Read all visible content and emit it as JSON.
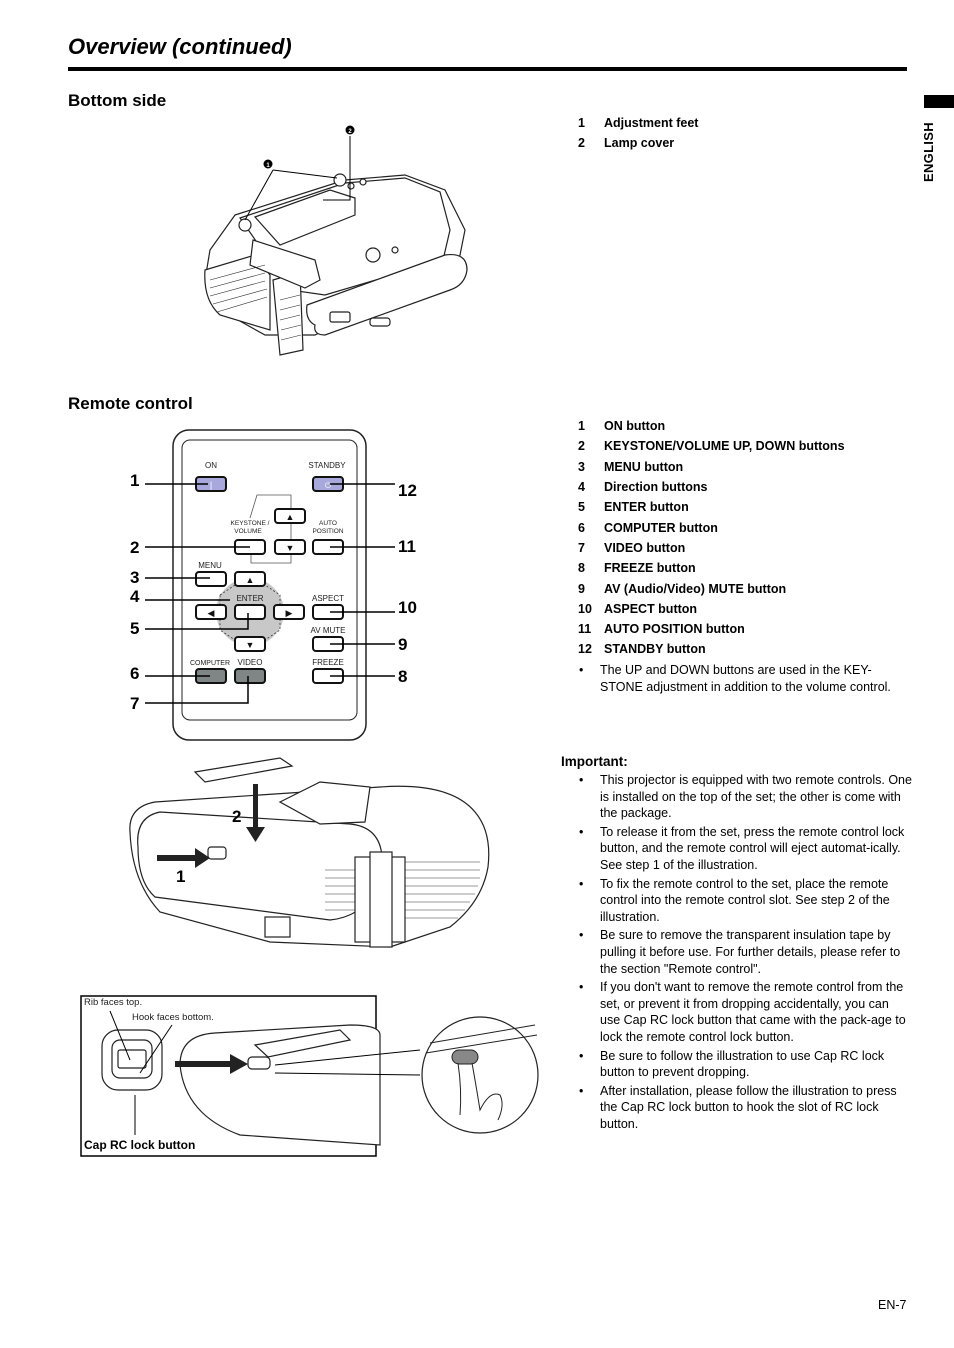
{
  "page": {
    "title": "Overview (continued)",
    "language_tab": "ENGLISH",
    "page_number": "EN-7"
  },
  "bottom_side": {
    "heading": "Bottom side",
    "callouts": [
      "1",
      "2"
    ],
    "items": [
      {
        "num": "1",
        "label": "Adjustment feet"
      },
      {
        "num": "2",
        "label": "Lamp cover"
      }
    ]
  },
  "remote_control": {
    "heading": "Remote control",
    "diagram": {
      "button_labels": {
        "on": "ON",
        "standby": "STANDBY",
        "keystone_volume_line1": "KEYSTONE /",
        "keystone_volume_line2": "VOLUME",
        "auto_position_line1": "AUTO",
        "auto_position_line2": "POSITION",
        "menu": "MENU",
        "enter": "ENTER",
        "aspect": "ASPECT",
        "av_mute": "AV MUTE",
        "computer": "COMPUTER",
        "video": "VIDEO",
        "freeze": "FREEZE"
      },
      "glyphs": {
        "on": "|",
        "standby": "⏻",
        "up": "▲",
        "down": "▼",
        "left": "◀",
        "right": "▶"
      },
      "callouts_left": [
        "1",
        "2",
        "3",
        "4",
        "5",
        "6",
        "7"
      ],
      "callouts_right": [
        "12",
        "11",
        "10",
        "9",
        "8"
      ],
      "colors": {
        "power_buttons": "#a9a8dc",
        "source_buttons": "#7f8685",
        "dpad_ring": "#c8c8c8"
      }
    },
    "items": [
      {
        "num": "1",
        "label": "ON button"
      },
      {
        "num": "2",
        "label": "KEYSTONE/VOLUME UP, DOWN buttons"
      },
      {
        "num": "3",
        "label": "MENU button"
      },
      {
        "num": "4",
        "label": "Direction buttons"
      },
      {
        "num": "5",
        "label": "ENTER button"
      },
      {
        "num": "6",
        "label": "COMPUTER button"
      },
      {
        "num": "7",
        "label": "VIDEO button"
      },
      {
        "num": "8",
        "label": "FREEZE button"
      },
      {
        "num": "9",
        "label": "AV (Audio/Video) MUTE button"
      },
      {
        "num": "10",
        "label": "ASPECT button"
      },
      {
        "num": "11",
        "label": "AUTO POSITION button"
      },
      {
        "num": "12",
        "label": "STANDBY button"
      }
    ],
    "note": "The UP and DOWN buttons are used in the KEY-STONE adjustment in addition to the volume control.",
    "note_line1": "The UP and DOWN buttons are used in the KEY-",
    "note_line2": "STONE adjustment in addition to the volume control."
  },
  "remote_mount_figure": {
    "step_labels": [
      "1",
      "2"
    ]
  },
  "cap_figure": {
    "rib_label": "Rib faces top.",
    "hook_label": "Hook faces bottom.",
    "caption": "Cap RC lock button"
  },
  "important": {
    "heading": "Important:",
    "bullet_char": "•",
    "items": [
      "This projector is equipped with two remote controls. One is installed on the top of the set; the other is come with the package.",
      "To release it from the set, press the remote control lock button, and the remote control will eject automat-ically. See step 1 of the illustration.",
      "To fix the remote control to the set, place the remote control into the remote control slot. See step 2 of the illustration.",
      "Be sure to remove the transparent insulation tape by pulling it before use. For further details, please refer to the section \"Remote control\".",
      "If you don't want to remove the remote control from the set, or prevent it from dropping accidentally, you can use Cap RC lock button that came with the pack-age to lock the remote control lock button.",
      "Be sure to follow the illustration to use Cap RC lock button to prevent dropping.",
      "After installation, please follow the illustration to press the Cap RC lock button to hook the slot of RC lock button."
    ]
  }
}
